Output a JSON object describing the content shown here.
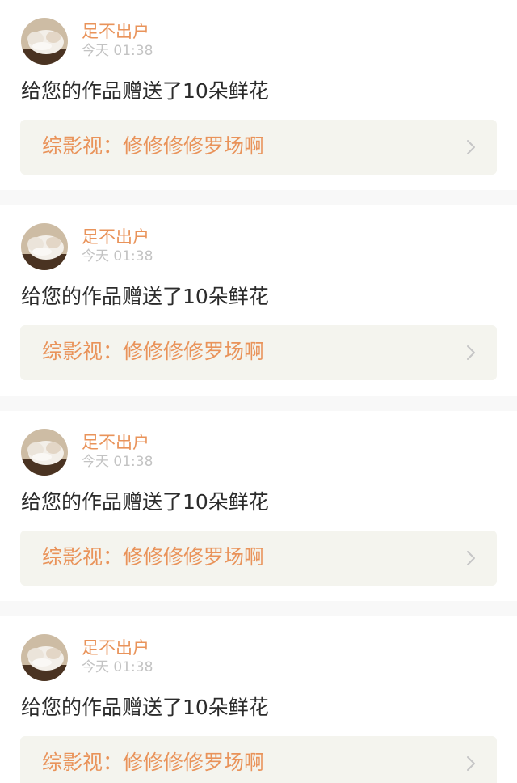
{
  "notifications": [
    {
      "username": "足不出户",
      "time": "今天 01:38",
      "message": "给您的作品赠送了10朵鲜花",
      "work_title": "综影视：修修修修罗场啊",
      "avatar_icon": "cat-avatar",
      "chevron_icon": "chevron-right-icon"
    },
    {
      "username": "足不出户",
      "time": "今天 01:38",
      "message": "给您的作品赠送了10朵鲜花",
      "work_title": "综影视：修修修修罗场啊",
      "avatar_icon": "cat-avatar",
      "chevron_icon": "chevron-right-icon"
    },
    {
      "username": "足不出户",
      "time": "今天 01:38",
      "message": "给您的作品赠送了10朵鲜花",
      "work_title": "综影视：修修修修罗场啊",
      "avatar_icon": "cat-avatar",
      "chevron_icon": "chevron-right-icon"
    },
    {
      "username": "足不出户",
      "time": "今天 01:38",
      "message": "给您的作品赠送了10朵鲜花",
      "work_title": "综影视：修修修修罗场啊",
      "avatar_icon": "cat-avatar",
      "chevron_icon": "chevron-right-icon"
    }
  ],
  "colors": {
    "accent": "#e9935a",
    "timestamp": "#c3c3c3",
    "message_text": "#2b2b2b",
    "link_background": "#f4f4ee",
    "divider": "#f8f8f8"
  }
}
